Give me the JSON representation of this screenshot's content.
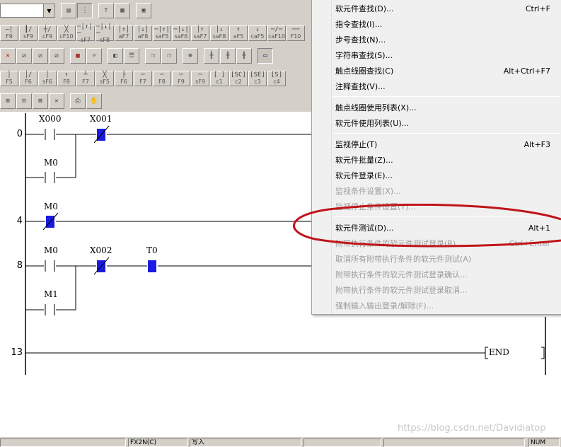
{
  "toolbar": {
    "row1": {
      "combo_value": ""
    },
    "row2": {
      "keys": [
        {
          "glyph": "—|",
          "label": "F9"
        },
        {
          "glyph": "┃/",
          "label": "sF9"
        },
        {
          "glyph": "┼/",
          "label": "cF9"
        },
        {
          "glyph": "╳",
          "label": "cF10"
        },
        {
          "glyph": "─|↑|─",
          "label": "sF7"
        },
        {
          "glyph": "─|↓|─",
          "label": "sF8"
        },
        {
          "glyph": "│↑│",
          "label": "aF7"
        },
        {
          "glyph": "│↓│",
          "label": "aF8"
        },
        {
          "glyph": "─|↑|",
          "label": "saF5"
        },
        {
          "glyph": "─|↓|",
          "label": "saF6"
        },
        {
          "glyph": "│↑",
          "label": "saF7"
        },
        {
          "glyph": "│↓",
          "label": "saF8"
        },
        {
          "glyph": "↑",
          "label": "aF5"
        },
        {
          "glyph": "↓",
          "label": "caF5"
        },
        {
          "glyph": "─/─",
          "label": "caF10"
        },
        {
          "glyph": "──",
          "label": "F10"
        }
      ]
    },
    "row4": {
      "keys": [
        {
          "glyph": "│",
          "label": "F5"
        },
        {
          "glyph": "│/",
          "label": "F6"
        },
        {
          "glyph": "│",
          "label": "sF6"
        },
        {
          "glyph": "↑",
          "label": "F8"
        },
        {
          "glyph": "┴",
          "label": "F7"
        },
        {
          "glyph": "╳",
          "label": "sF5"
        },
        {
          "glyph": "├",
          "label": "F6"
        },
        {
          "glyph": "─",
          "label": "F7"
        },
        {
          "glyph": "─",
          "label": "F8"
        },
        {
          "glyph": "─",
          "label": "F9"
        },
        {
          "glyph": "─",
          "label": "sF9"
        },
        {
          "glyph": "[ ]",
          "label": "c1"
        },
        {
          "glyph": "[SC]",
          "label": "c2"
        },
        {
          "glyph": "[SE]",
          "label": "c3"
        },
        {
          "glyph": "[S]",
          "label": "c4"
        }
      ]
    }
  },
  "ladder": {
    "steps": [
      {
        "no": "0"
      },
      {
        "no": "4"
      },
      {
        "no": "8"
      },
      {
        "no": "13"
      }
    ],
    "devices": {
      "x000": "X000",
      "x001": "X001",
      "m0_a": "M0",
      "m0_b": "M0",
      "m0_c": "M0",
      "x002": "X002",
      "t0": "T0",
      "m1": "M1"
    },
    "end_label": "END"
  },
  "context_menu": {
    "items": [
      {
        "label": "软元件查找(D)...",
        "shortcut": "Ctrl+F",
        "disabled": false
      },
      {
        "label": "指令查找(I)...",
        "shortcut": "",
        "disabled": false
      },
      {
        "label": "步号查找(N)...",
        "shortcut": "",
        "disabled": false
      },
      {
        "label": "字符串查找(S)...",
        "shortcut": "",
        "disabled": false
      },
      {
        "label": "触点线圈查找(C)",
        "shortcut": "Alt+Ctrl+F7",
        "disabled": false
      },
      {
        "label": "注释查找(V)...",
        "shortcut": "",
        "disabled": false
      },
      {
        "label": "触点线圈使用列表(X)...",
        "shortcut": "",
        "disabled": false
      },
      {
        "label": "软元件使用列表(U)...",
        "shortcut": "",
        "disabled": false
      },
      {
        "label": "监视停止(T)",
        "shortcut": "Alt+F3",
        "disabled": false
      },
      {
        "label": "软元件批量(Z)...",
        "shortcut": "",
        "disabled": false
      },
      {
        "label": "软元件登录(E)...",
        "shortcut": "",
        "disabled": false
      },
      {
        "label": "监视条件设置(X)...",
        "shortcut": "",
        "disabled": true
      },
      {
        "label": "监视停止条件设置(Y)...",
        "shortcut": "",
        "disabled": true
      },
      {
        "label": "软元件测试(D)...",
        "shortcut": "Alt+1",
        "disabled": false
      },
      {
        "label": "附带执行条件的软元件测试登录(R)...",
        "shortcut": "Ctrl+Enter",
        "disabled": true
      },
      {
        "label": "取消所有附带执行条件的软元件测试(A)",
        "shortcut": "",
        "disabled": true
      },
      {
        "label": "附带执行条件的软元件测试登录确认...",
        "shortcut": "",
        "disabled": true
      },
      {
        "label": "附带执行条件的软元件测试登录取消...",
        "shortcut": "",
        "disabled": true
      },
      {
        "label": "强制输入输出登录/解除(F)...",
        "shortcut": "",
        "disabled": true
      }
    ]
  },
  "statusbar": {
    "plc": "FX2N(C)",
    "mode": "写入",
    "num": "NUM"
  },
  "watermark": "https://blog.csdn.net/Davidiatop"
}
